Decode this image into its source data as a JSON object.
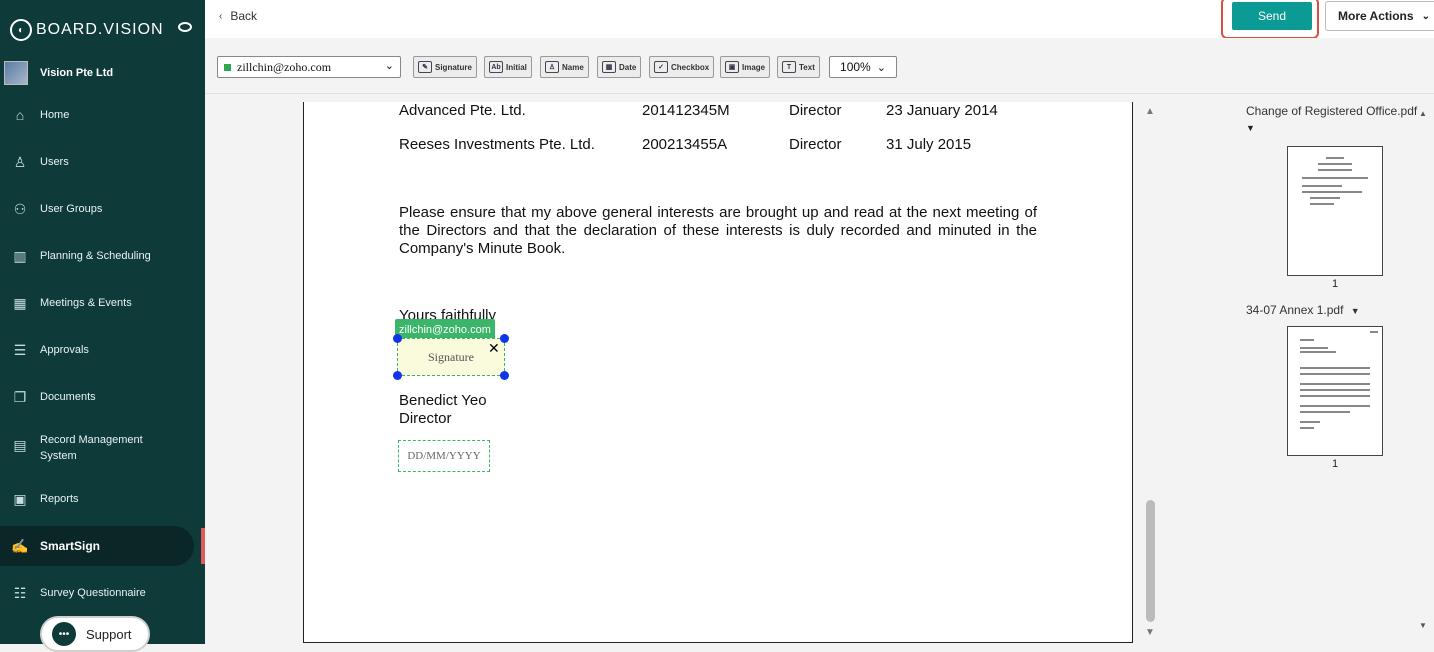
{
  "app": {
    "brand": "BOARD.VISION",
    "org_name": "Vision Pte Ltd",
    "accent": "#0b9b94",
    "sidebar_bg": "#0e3a3a"
  },
  "sidebar": {
    "items": [
      {
        "label": "Home",
        "icon": "home-icon"
      },
      {
        "label": "Users",
        "icon": "user-icon"
      },
      {
        "label": "User Groups",
        "icon": "users-icon"
      },
      {
        "label": "Planning & Scheduling",
        "icon": "chart-icon"
      },
      {
        "label": "Meetings & Events",
        "icon": "calendar-icon"
      },
      {
        "label": "Approvals",
        "icon": "approvals-icon"
      },
      {
        "label": "Documents",
        "icon": "documents-icon"
      },
      {
        "label": "Record Management",
        "label2": "System",
        "icon": "record-icon"
      },
      {
        "label": "Reports",
        "icon": "reports-icon"
      },
      {
        "label": "SmartSign",
        "icon": "signature-icon",
        "active": true
      },
      {
        "label": "Survey Questionnaire",
        "icon": "survey-icon"
      }
    ],
    "support_label": "Support"
  },
  "topbar": {
    "back_label": "Back",
    "send_label": "Send",
    "more_label": "More Actions"
  },
  "toolbar": {
    "recipient": "zillchin@zoho.com",
    "tools": [
      "Signature",
      "Initial",
      "Name",
      "Date",
      "Checkbox",
      "Image",
      "Text"
    ],
    "zoom": "100%"
  },
  "document": {
    "rows": [
      {
        "company": "Advanced Pte. Ltd.",
        "reg_no": "201412345M",
        "role": "Director",
        "date": "23 January 2014"
      },
      {
        "company": "Reeses Investments Pte. Ltd.",
        "reg_no": "200213455A",
        "role": "Director",
        "date": "31 July 2015"
      }
    ],
    "paragraph": "Please ensure that my above general interests are brought up and read at the next meeting of the Directors and that the declaration of these interests is duly recorded and minuted in the Company's Minute Book.",
    "closing": "Yours faithfully",
    "signature_owner": "zillchin@zoho.com",
    "signature_placeholder": "Signature",
    "signer_name": "Benedict Yeo",
    "signer_title": "Director",
    "date_placeholder": "DD/MM/YYYY"
  },
  "files": [
    {
      "name": "Change of Registered Office.pdf",
      "page": "1"
    },
    {
      "name": "34-07 Annex 1.pdf",
      "page": "1"
    }
  ]
}
